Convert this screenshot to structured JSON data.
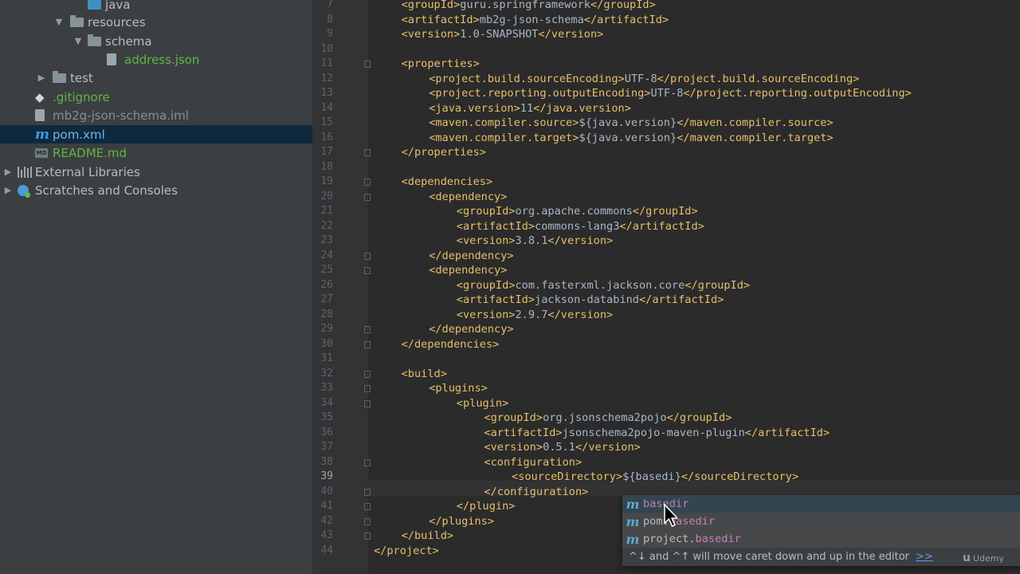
{
  "tree": [
    {
      "label": "java",
      "indent": 2,
      "arrow": "",
      "icon": "folder-blue",
      "color": "normal"
    },
    {
      "label": "resources",
      "indent": 1,
      "arrow": "▼",
      "icon": "folder-res",
      "color": "normal"
    },
    {
      "label": "schema",
      "indent": 2,
      "arrow": "▼",
      "icon": "folder",
      "color": "normal"
    },
    {
      "label": "address.json",
      "indent": 3,
      "arrow": "",
      "icon": "json-file",
      "color": "green"
    },
    {
      "label": "test",
      "indent": 0,
      "arrow": "▶",
      "icon": "folder",
      "color": "normal"
    },
    {
      "label": ".gitignore",
      "indent": -1,
      "arrow": "",
      "icon": "git",
      "color": "green"
    },
    {
      "label": "mb2g-json-schema.iml",
      "indent": -1,
      "arrow": "",
      "icon": "file",
      "color": "gray"
    },
    {
      "label": "pom.xml",
      "indent": -1,
      "arrow": "",
      "icon": "maven",
      "color": "blue",
      "selected": true
    },
    {
      "label": "README.md",
      "indent": -1,
      "arrow": "",
      "icon": "md",
      "color": "green"
    },
    {
      "label": "External Libraries",
      "indent": -2,
      "arrow": "▶",
      "icon": "library",
      "color": "normal"
    },
    {
      "label": "Scratches and Consoles",
      "indent": -2,
      "arrow": "▶",
      "icon": "scratch",
      "color": "normal"
    }
  ],
  "editor": {
    "current_line": 39,
    "lines": [
      {
        "n": 7,
        "indent": 1,
        "parts": [
          [
            "tag",
            "<groupId>"
          ],
          [
            "txt",
            "guru.springframework"
          ],
          [
            "tag",
            "</groupId>"
          ]
        ]
      },
      {
        "n": 8,
        "indent": 1,
        "parts": [
          [
            "tag",
            "<artifactId>"
          ],
          [
            "txt",
            "mb2g-json-schema"
          ],
          [
            "tag",
            "</artifactId>"
          ]
        ]
      },
      {
        "n": 9,
        "indent": 1,
        "parts": [
          [
            "tag",
            "<version>"
          ],
          [
            "txt",
            "1.0-SNAPSHOT"
          ],
          [
            "tag",
            "</version>"
          ]
        ]
      },
      {
        "n": 10,
        "indent": 1,
        "parts": []
      },
      {
        "n": 11,
        "indent": 1,
        "fold": true,
        "parts": [
          [
            "tag",
            "<properties>"
          ]
        ]
      },
      {
        "n": 12,
        "indent": 2,
        "parts": [
          [
            "tag",
            "<project.build.sourceEncoding>"
          ],
          [
            "txt",
            "UTF-8"
          ],
          [
            "tag",
            "</project.build.sourceEncoding>"
          ]
        ]
      },
      {
        "n": 13,
        "indent": 2,
        "parts": [
          [
            "tag",
            "<project.reporting.outputEncoding>"
          ],
          [
            "txt",
            "UTF-8"
          ],
          [
            "tag",
            "</project.reporting.outputEncoding>"
          ]
        ]
      },
      {
        "n": 14,
        "indent": 2,
        "parts": [
          [
            "tag",
            "<java.version>"
          ],
          [
            "txt",
            "11"
          ],
          [
            "tag",
            "</java.version>"
          ]
        ]
      },
      {
        "n": 15,
        "indent": 2,
        "parts": [
          [
            "tag",
            "<maven.compiler.source>"
          ],
          [
            "txt",
            "${java.version}"
          ],
          [
            "tag",
            "</maven.compiler.source>"
          ]
        ]
      },
      {
        "n": 16,
        "indent": 2,
        "parts": [
          [
            "tag",
            "<maven.compiler.target>"
          ],
          [
            "txt",
            "${java.version}"
          ],
          [
            "tag",
            "</maven.compiler.target>"
          ]
        ]
      },
      {
        "n": 17,
        "indent": 1,
        "fold": true,
        "parts": [
          [
            "tag",
            "</properties>"
          ]
        ]
      },
      {
        "n": 18,
        "indent": 1,
        "parts": []
      },
      {
        "n": 19,
        "indent": 1,
        "fold": true,
        "parts": [
          [
            "tag",
            "<dependencies>"
          ]
        ]
      },
      {
        "n": 20,
        "indent": 2,
        "fold": true,
        "parts": [
          [
            "tag",
            "<dependency>"
          ]
        ]
      },
      {
        "n": 21,
        "indent": 3,
        "parts": [
          [
            "tag",
            "<groupId>"
          ],
          [
            "txt",
            "org.apache.commons"
          ],
          [
            "tag",
            "</groupId>"
          ]
        ]
      },
      {
        "n": 22,
        "indent": 3,
        "parts": [
          [
            "tag",
            "<artifactId>"
          ],
          [
            "txt",
            "commons-lang3"
          ],
          [
            "tag",
            "</artifactId>"
          ]
        ]
      },
      {
        "n": 23,
        "indent": 3,
        "parts": [
          [
            "tag",
            "<version>"
          ],
          [
            "txt",
            "3.8.1"
          ],
          [
            "tag",
            "</version>"
          ]
        ]
      },
      {
        "n": 24,
        "indent": 2,
        "fold": true,
        "parts": [
          [
            "tag",
            "</dependency>"
          ]
        ]
      },
      {
        "n": 25,
        "indent": 2,
        "fold": true,
        "parts": [
          [
            "tag",
            "<dependency>"
          ]
        ]
      },
      {
        "n": 26,
        "indent": 3,
        "parts": [
          [
            "tag",
            "<groupId>"
          ],
          [
            "txt",
            "com.fasterxml.jackson.core"
          ],
          [
            "tag",
            "</groupId>"
          ]
        ]
      },
      {
        "n": 27,
        "indent": 3,
        "parts": [
          [
            "tag",
            "<artifactId>"
          ],
          [
            "txt",
            "jackson-databind"
          ],
          [
            "tag",
            "</artifactId>"
          ]
        ]
      },
      {
        "n": 28,
        "indent": 3,
        "parts": [
          [
            "tag",
            "<version>"
          ],
          [
            "txt",
            "2.9.7"
          ],
          [
            "tag",
            "</version>"
          ]
        ]
      },
      {
        "n": 29,
        "indent": 2,
        "fold": true,
        "parts": [
          [
            "tag",
            "</dependency>"
          ]
        ]
      },
      {
        "n": 30,
        "indent": 1,
        "fold": true,
        "parts": [
          [
            "tag",
            "</dependencies>"
          ]
        ]
      },
      {
        "n": 31,
        "indent": 1,
        "parts": []
      },
      {
        "n": 32,
        "indent": 1,
        "fold": true,
        "parts": [
          [
            "tag",
            "<build>"
          ]
        ]
      },
      {
        "n": 33,
        "indent": 2,
        "fold": true,
        "parts": [
          [
            "tag",
            "<plugins>"
          ]
        ]
      },
      {
        "n": 34,
        "indent": 3,
        "fold": true,
        "parts": [
          [
            "tag",
            "<plugin>"
          ]
        ]
      },
      {
        "n": 35,
        "indent": 4,
        "parts": [
          [
            "tag",
            "<groupId>"
          ],
          [
            "txt",
            "org.jsonschema2pojo"
          ],
          [
            "tag",
            "</groupId>"
          ]
        ]
      },
      {
        "n": 36,
        "indent": 4,
        "parts": [
          [
            "tag",
            "<artifactId>"
          ],
          [
            "txt",
            "jsonschema2pojo-maven-plugin"
          ],
          [
            "tag",
            "</artifactId>"
          ]
        ]
      },
      {
        "n": 37,
        "indent": 4,
        "parts": [
          [
            "tag",
            "<version>"
          ],
          [
            "txt",
            "0.5.1"
          ],
          [
            "tag",
            "</version>"
          ]
        ]
      },
      {
        "n": 38,
        "indent": 4,
        "fold": true,
        "parts": [
          [
            "tag",
            "<configuration>"
          ]
        ]
      },
      {
        "n": 39,
        "indent": 5,
        "parts": [
          [
            "tag",
            "<sourceDirectory>"
          ],
          [
            "txt",
            "${basedi}"
          ],
          [
            "tag",
            "</sourceDirectory>"
          ]
        ]
      },
      {
        "n": 40,
        "indent": 4,
        "fold": true,
        "parts": [
          [
            "tag",
            "</configuration>"
          ]
        ]
      },
      {
        "n": 41,
        "indent": 3,
        "fold": true,
        "parts": [
          [
            "tag",
            "</plugin>"
          ]
        ]
      },
      {
        "n": 42,
        "indent": 2,
        "fold": true,
        "parts": [
          [
            "tag",
            "</plugins>"
          ]
        ]
      },
      {
        "n": 43,
        "indent": 1,
        "fold": true,
        "parts": [
          [
            "tag",
            "</build>"
          ]
        ]
      },
      {
        "n": 44,
        "indent": 0,
        "parts": [
          [
            "tag",
            "</project>"
          ]
        ]
      }
    ]
  },
  "autocomplete": {
    "items": [
      {
        "prefix": "",
        "match": "basedir",
        "suffix": "",
        "selected": true
      },
      {
        "prefix": "pom.",
        "match": "basedir",
        "suffix": "",
        "selected": false
      },
      {
        "prefix": "project.",
        "match": "basedir",
        "suffix": "",
        "selected": false
      }
    ],
    "hint": "^↓ and ^↑ will move caret down and up in the editor",
    "hint_link": ">>"
  },
  "watermark": "Udemy",
  "colors": {
    "tag": "#e8bf6a",
    "text": "#a9b7c6",
    "match": "#c77dbb",
    "green_file": "#62b543",
    "maven": "#3d9be9"
  }
}
